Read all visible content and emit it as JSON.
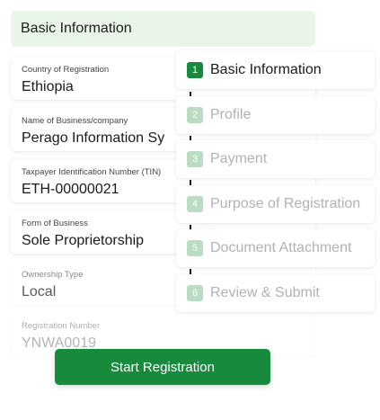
{
  "header": {
    "title": "Basic Information"
  },
  "fields": [
    {
      "label": "Country of Registration",
      "value": "Ethiopia"
    },
    {
      "label": "Name of Business/company",
      "value": "Perago Information Sy"
    },
    {
      "label": "Taxpayer Identification Number (TIN)",
      "value": "ETH-00000021"
    },
    {
      "label": "Form of Business",
      "value": "Sole Proprietorship"
    },
    {
      "label": "Ownership Type",
      "value": "Local"
    },
    {
      "label": "Registration Number",
      "value": "YNWA0019"
    }
  ],
  "steps": [
    {
      "number": "1",
      "label": "Basic Information",
      "state": "active"
    },
    {
      "number": "2",
      "label": "Profile",
      "state": "inactive"
    },
    {
      "number": "3",
      "label": "Payment",
      "state": "inactive"
    },
    {
      "number": "4",
      "label": "Purpose of Registration",
      "state": "inactive"
    },
    {
      "number": "5",
      "label": "Document Attachment",
      "state": "inactive"
    },
    {
      "number": "6",
      "label": "Review & Submit",
      "state": "inactive"
    }
  ],
  "cta": {
    "label": "Start Registration"
  },
  "colors": {
    "accent": "#188a3c",
    "accent_light": "#b9dcc2",
    "header_bg": "#eaf5ea"
  }
}
